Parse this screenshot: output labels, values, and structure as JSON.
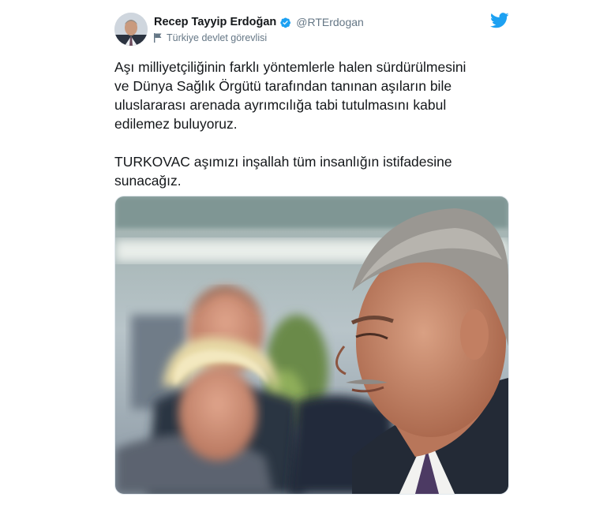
{
  "author": {
    "display_name": "Recep Tayyip Erdoğan",
    "handle": "@RTErdogan",
    "verified": true,
    "label": "Türkiye devlet görevlisi",
    "avatar_icon": "profile-photo",
    "label_icon": "flag-icon"
  },
  "platform": {
    "logo_icon": "twitter-bird-icon",
    "brand_color": "#1da1f2"
  },
  "tweet": {
    "paragraph_1": "Aşı milliyetçiliğinin farklı yöntemlerle halen sürdürülmesini\nve Dünya Sağlık Örgütü tarafından tanınan aşıların bile\nuluslararası arenada ayrımcılığa tabi tutulmasını kabul\nedilemez buluyoruz.",
    "paragraph_2": "TURKOVAC aşımızı inşallah tüm insanlığın istifadesine\nsunacağız."
  },
  "media": {
    "type": "photo"
  }
}
